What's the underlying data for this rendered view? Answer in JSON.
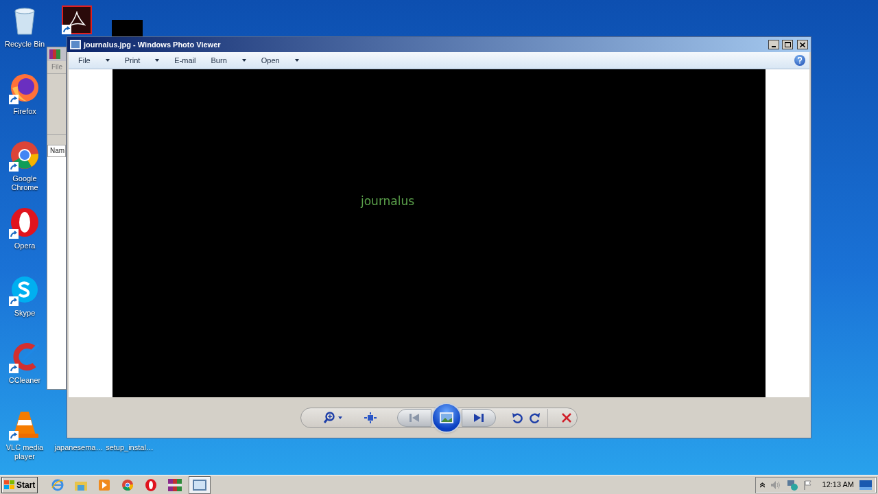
{
  "desktop_icons": [
    {
      "label": "Recycle Bin",
      "kind": "recycle"
    },
    {
      "label": "Firefox",
      "kind": "firefox"
    },
    {
      "label": "Google Chrome",
      "kind": "chrome"
    },
    {
      "label": "Opera",
      "kind": "opera"
    },
    {
      "label": "Skype",
      "kind": "skype"
    },
    {
      "label": "CCleaner",
      "kind": "ccleaner"
    },
    {
      "label": "VLC media player",
      "kind": "vlc"
    }
  ],
  "bottom_icons": [
    {
      "label": "japanesema…"
    },
    {
      "label": "setup_instal…"
    }
  ],
  "background_window": {
    "menu": "File",
    "column_header": "Nam"
  },
  "photo_viewer": {
    "title": "journalus.jpg - Windows Photo Viewer",
    "menu": [
      {
        "label": "File",
        "dropdown": true
      },
      {
        "label": "Print",
        "dropdown": true
      },
      {
        "label": "E-mail",
        "dropdown": false
      },
      {
        "label": "Burn",
        "dropdown": true
      },
      {
        "label": "Open",
        "dropdown": true
      }
    ],
    "image_text": "journalus",
    "controls": [
      {
        "kind": "zoom"
      },
      {
        "kind": "fit"
      },
      {
        "kind": "prev"
      },
      {
        "kind": "slideshow"
      },
      {
        "kind": "next"
      },
      {
        "kind": "rotate_left"
      },
      {
        "kind": "rotate_right"
      },
      {
        "kind": "delete"
      }
    ]
  },
  "taskbar": {
    "start": "Start",
    "apps": [
      {
        "kind": "ie",
        "selected": false
      },
      {
        "kind": "explorer",
        "selected": false
      },
      {
        "kind": "media",
        "selected": false
      },
      {
        "kind": "chrome",
        "selected": false
      },
      {
        "kind": "opera",
        "selected": false
      },
      {
        "kind": "winrar",
        "selected": false
      },
      {
        "kind": "photo",
        "selected": true
      }
    ],
    "clock": "12:13 AM"
  }
}
